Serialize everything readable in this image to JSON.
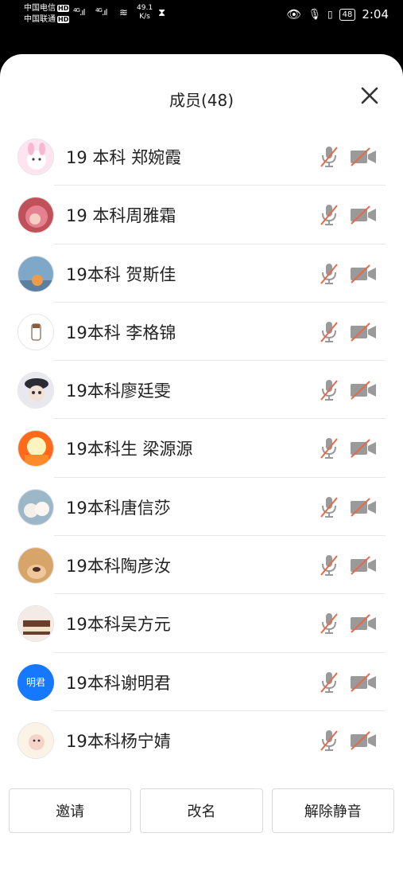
{
  "status_bar": {
    "carrier1": "中国电信",
    "carrier2": "中国联通",
    "hd_badge": "HD",
    "network1": "4G",
    "network2": "4G",
    "speed_value": "49.1",
    "speed_unit": "K/s",
    "battery": "48",
    "time": "2:04"
  },
  "sheet": {
    "title": "成员(48)"
  },
  "members": [
    {
      "name": "19 本科 郑婉霞",
      "avatar": "pink-bunny-cartoon"
    },
    {
      "name": "19 本科周雅霜",
      "avatar": "pink-hair-girl"
    },
    {
      "name": "19本科 贺斯佳",
      "avatar": "orange-cat-blue-sky"
    },
    {
      "name": "19本科 李格锦",
      "avatar": "doodle-figure"
    },
    {
      "name": "19本科廖廷雯",
      "avatar": "girl-with-hat"
    },
    {
      "name": "19本科生 梁源源",
      "avatar": "cartoon-cat-orange"
    },
    {
      "name": "19本科唐信莎",
      "avatar": "white-puppies"
    },
    {
      "name": "19本科陶彦汝",
      "avatar": "dog-face"
    },
    {
      "name": "19本科吴方元",
      "avatar": "cake-dessert"
    },
    {
      "name": "19本科谢明君",
      "avatar_text": "明君",
      "avatar_color": "#1677ff"
    },
    {
      "name": "19本科杨宁婧",
      "avatar": "cartoon-characters"
    }
  ],
  "footer": {
    "invite_label": "邀请",
    "rename_label": "改名",
    "unmute_label": "解除静音"
  },
  "colors": {
    "mute_slash": "#e8694a",
    "icon_gray": "#9a9a9a"
  }
}
